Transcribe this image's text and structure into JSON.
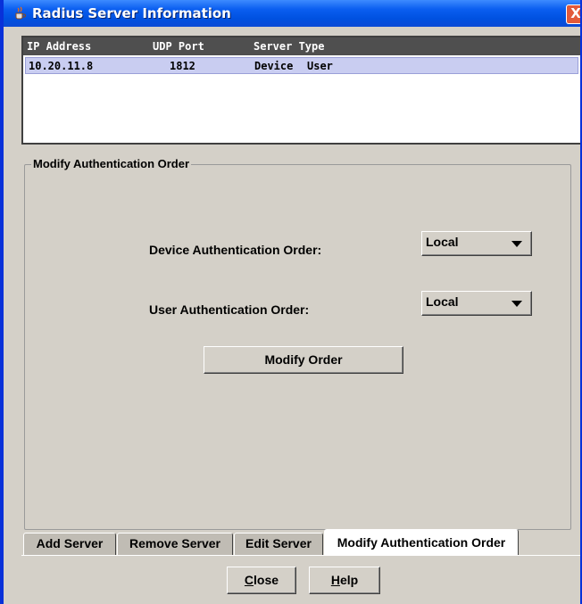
{
  "window": {
    "title": "Radius Server Information",
    "close_glyph": "X"
  },
  "table": {
    "headers": [
      "IP Address",
      "UDP Port",
      "Server Type"
    ],
    "rows": [
      {
        "ip": "10.20.11.8",
        "port": "1812",
        "type_device": "Device",
        "type_user": "User"
      }
    ]
  },
  "group": {
    "title": "Modify Authentication Order",
    "device_label": "Device Authentication Order:",
    "device_value": "Local",
    "user_label": "User Authentication Order:",
    "user_value": "Local",
    "modify_button": "Modify Order"
  },
  "tabs": [
    {
      "label": "Add Server",
      "active": false
    },
    {
      "label": "Remove Server",
      "active": false
    },
    {
      "label": "Edit Server",
      "active": false
    },
    {
      "label": "Modify Authentication Order",
      "active": true
    }
  ],
  "footer": {
    "close_first": "C",
    "close_rest": "lose",
    "help_first": "H",
    "help_rest": "elp"
  },
  "colors": {
    "titlebar": "#0a5ef0",
    "selection": "#c9cdf1",
    "header": "#4f4f4f",
    "window_bg": "#d4d0c8"
  },
  "icons": [
    "java-cup-icon",
    "close-icon",
    "chevron-down-icon"
  ]
}
